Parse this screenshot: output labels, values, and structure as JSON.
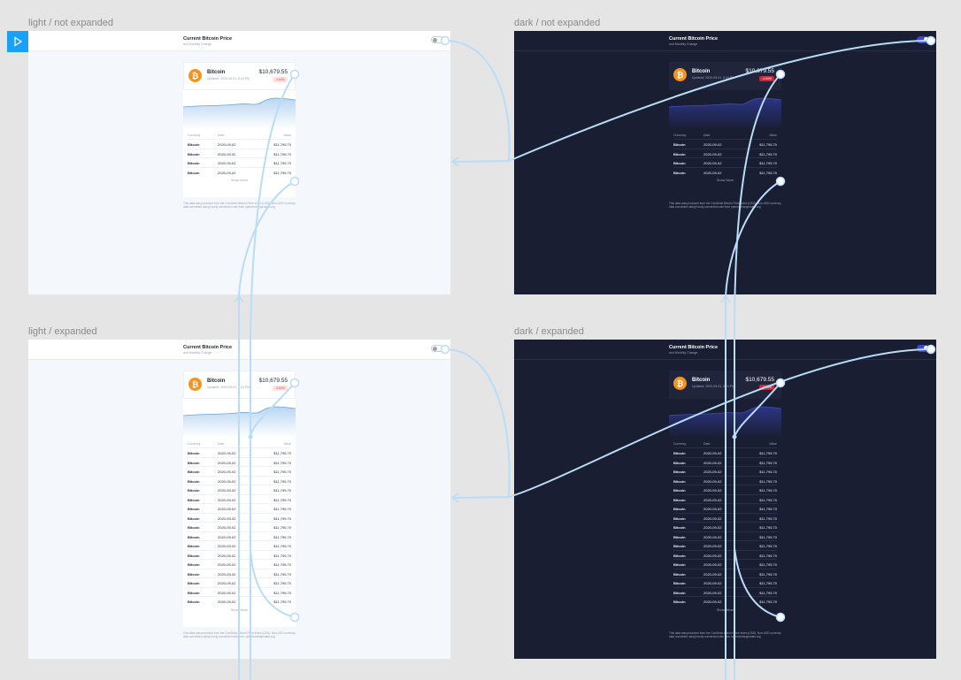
{
  "canvas": {
    "frames": [
      {
        "id": "light-not-expanded",
        "label": "light / not expanded",
        "theme": "light"
      },
      {
        "id": "dark-not-expanded",
        "label": "dark / not expanded",
        "theme": "dark"
      },
      {
        "id": "light-expanded",
        "label": "light / expanded",
        "theme": "light"
      },
      {
        "id": "dark-expanded",
        "label": "dark / expanded",
        "theme": "dark"
      }
    ]
  },
  "app": {
    "title": "Current Bitcoin Price",
    "subtitle": "and Monthly Change",
    "coin": {
      "name": "Bitcoin",
      "updated": "Updated: 2020-09-01, 5:24 PM",
      "price": "$10,679.55",
      "change": "-4.64%",
      "icon": "bitcoin-icon"
    },
    "table": {
      "headers": [
        "Currency",
        "Date",
        "Value"
      ],
      "row": {
        "currency": "Bitcoin",
        "date": "2020-09-02",
        "value": "$11,795.70"
      }
    },
    "show_more": "Show More",
    "footnote": "This data was produced from the CoinDesk Bitcoin Price Index (USD). Non-USD currency data converted using hourly conversion rate from openexchangerates.org"
  },
  "colors": {
    "accent": "#18a0fb",
    "connector": "#b9dcf7",
    "bitcoin_orange": "#f7931a",
    "light_bg": "#f4f8fc",
    "dark_bg": "#1a1e32"
  }
}
